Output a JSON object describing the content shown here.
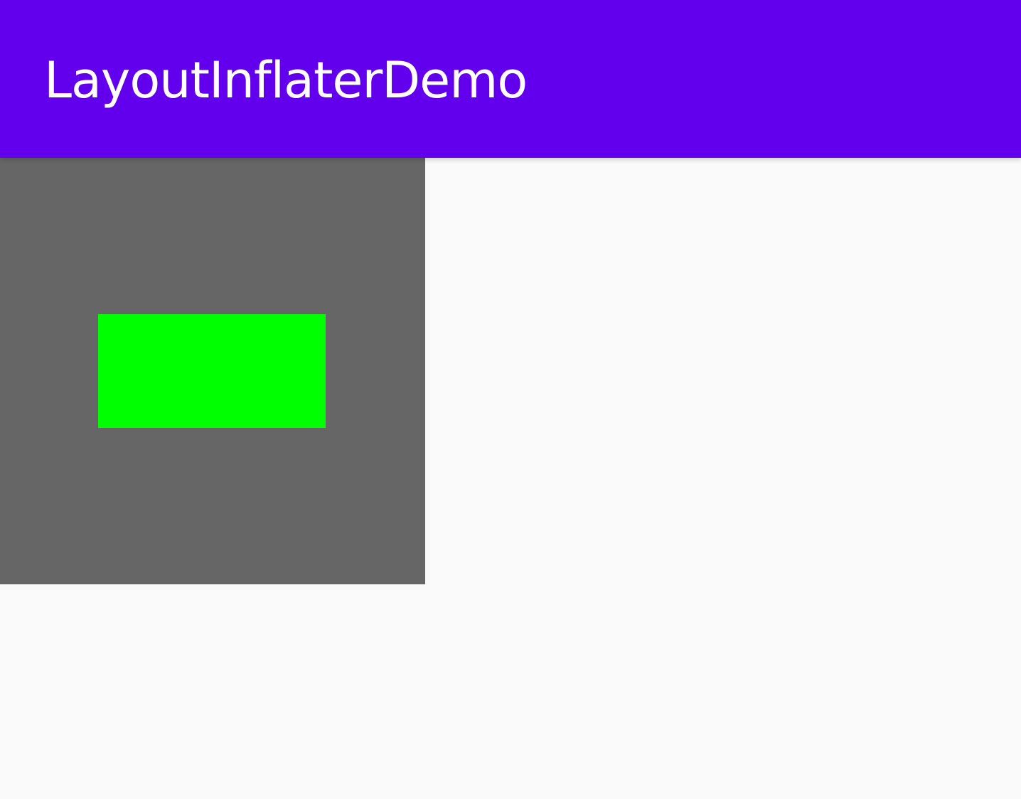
{
  "app_bar": {
    "title": "LayoutInflaterDemo",
    "background_color": "#6200ee",
    "title_color": "#ffffff"
  },
  "content": {
    "background_color": "#fafafa",
    "container": {
      "background_color": "#666666",
      "child": {
        "background_color": "#00ff00"
      }
    }
  }
}
